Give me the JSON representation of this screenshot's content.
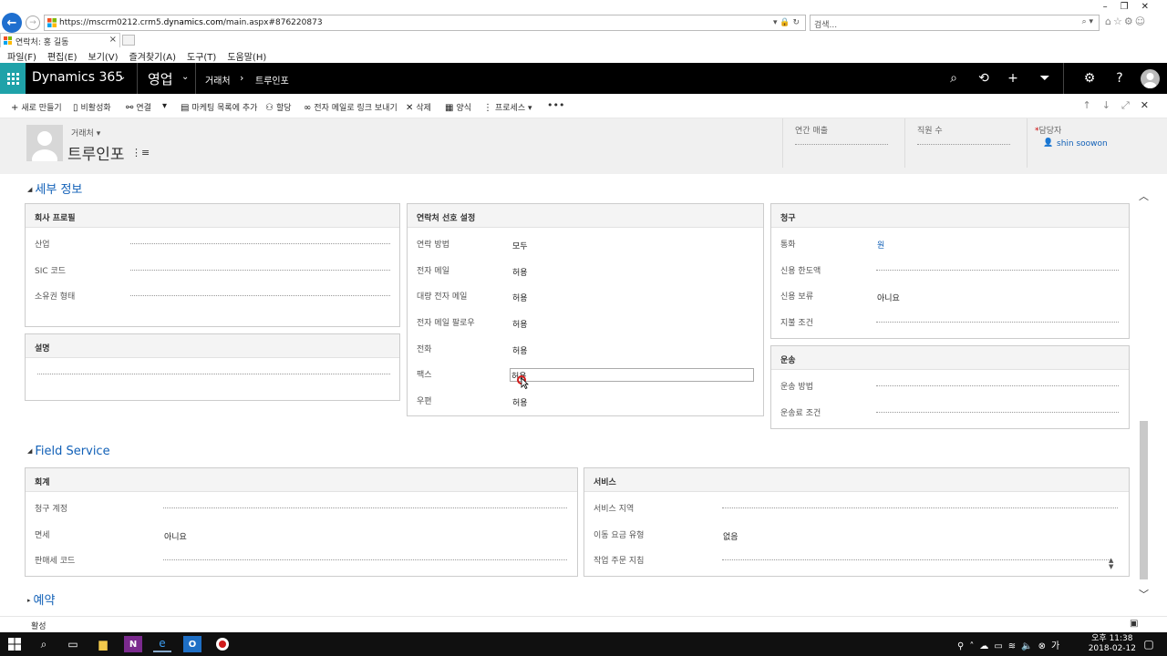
{
  "browser": {
    "url_prefix": "https://mscrm0212.crm5.",
    "url_host": "dynamics.com",
    "url_suffix": "/main.aspx#876220873",
    "search_placeholder": "검색...",
    "tab_title": "연락처: 홍 길동",
    "menu": [
      "파일(F)",
      "편집(E)",
      "보기(V)",
      "즐겨찾기(A)",
      "도구(T)",
      "도움말(H)"
    ]
  },
  "app": {
    "name": "Dynamics 365",
    "area": "영업",
    "breadcrumb": [
      "거래처",
      "트루인포"
    ]
  },
  "commands": [
    {
      "icon": "+",
      "label": "새로 만들기"
    },
    {
      "icon": "▯",
      "label": "비활성화"
    },
    {
      "icon": "⚯",
      "label": "연결"
    },
    {
      "icon": "▾",
      "label": ""
    },
    {
      "icon": "▤",
      "label": "마케팅 목록에 추가"
    },
    {
      "icon": "⚇",
      "label": "할당"
    },
    {
      "icon": "∞",
      "label": "전자 메일로 링크 보내기"
    },
    {
      "icon": "✕",
      "label": "삭제"
    },
    {
      "icon": "▦",
      "label": "양식"
    },
    {
      "icon": "⋮",
      "label": "프로세스 ▾"
    },
    {
      "icon": "•••",
      "label": ""
    }
  ],
  "record": {
    "entity_type": "거래처",
    "name": "트루인포",
    "header_fields": [
      {
        "label": "연간 매출",
        "value": ""
      },
      {
        "label": "직원 수",
        "value": ""
      }
    ],
    "owner_label": "담당자",
    "owner_value": "shin soowon"
  },
  "sections": {
    "details": {
      "title": "세부 정보",
      "company_profile": {
        "title": "회사 프로필",
        "fields": [
          {
            "label": "산업",
            "value": ""
          },
          {
            "label": "SIC 코드",
            "value": ""
          },
          {
            "label": "소유권 형태",
            "value": ""
          }
        ]
      },
      "description": {
        "title": "설명"
      },
      "contact_prefs": {
        "title": "연락처 선호 설정",
        "fields": [
          {
            "label": "연락 방법",
            "value": "모두"
          },
          {
            "label": "전자 메일",
            "value": "허용"
          },
          {
            "label": "대량 전자 메일",
            "value": "허용"
          },
          {
            "label": "전자 메일 팔로우",
            "value": "허용"
          },
          {
            "label": "전화",
            "value": "허용"
          },
          {
            "label": "팩스",
            "value": "허용"
          },
          {
            "label": "우편",
            "value": "허용"
          }
        ]
      },
      "billing": {
        "title": "청구",
        "fields": [
          {
            "label": "통화",
            "value": "원"
          },
          {
            "label": "신용 한도액",
            "value": ""
          },
          {
            "label": "신용 보류",
            "value": "아니요"
          },
          {
            "label": "지불 조건",
            "value": ""
          }
        ]
      },
      "shipping": {
        "title": "운송",
        "fields": [
          {
            "label": "운송 방법",
            "value": ""
          },
          {
            "label": "운송료 조건",
            "value": ""
          }
        ]
      }
    },
    "field_service": {
      "title": "Field Service",
      "accounting": {
        "title": "회계",
        "fields": [
          {
            "label": "청구 계정",
            "value": ""
          },
          {
            "label": "면세",
            "value": "아니요"
          },
          {
            "label": "판매세 코드",
            "value": ""
          }
        ]
      },
      "service": {
        "title": "서비스",
        "fields": [
          {
            "label": "서비스 지역",
            "value": ""
          },
          {
            "label": "이동 요금 유형",
            "value": "없음"
          },
          {
            "label": "작업 주문 지침",
            "value": ""
          }
        ]
      }
    },
    "reservations": {
      "title": "예약"
    }
  },
  "status": {
    "text": "활성"
  },
  "taskbar": {
    "time": "오후 11:38",
    "date": "2018-02-12"
  },
  "colors": {
    "accent": "#1fa2a9",
    "link": "#1160b7",
    "header_bg": "#000000"
  }
}
